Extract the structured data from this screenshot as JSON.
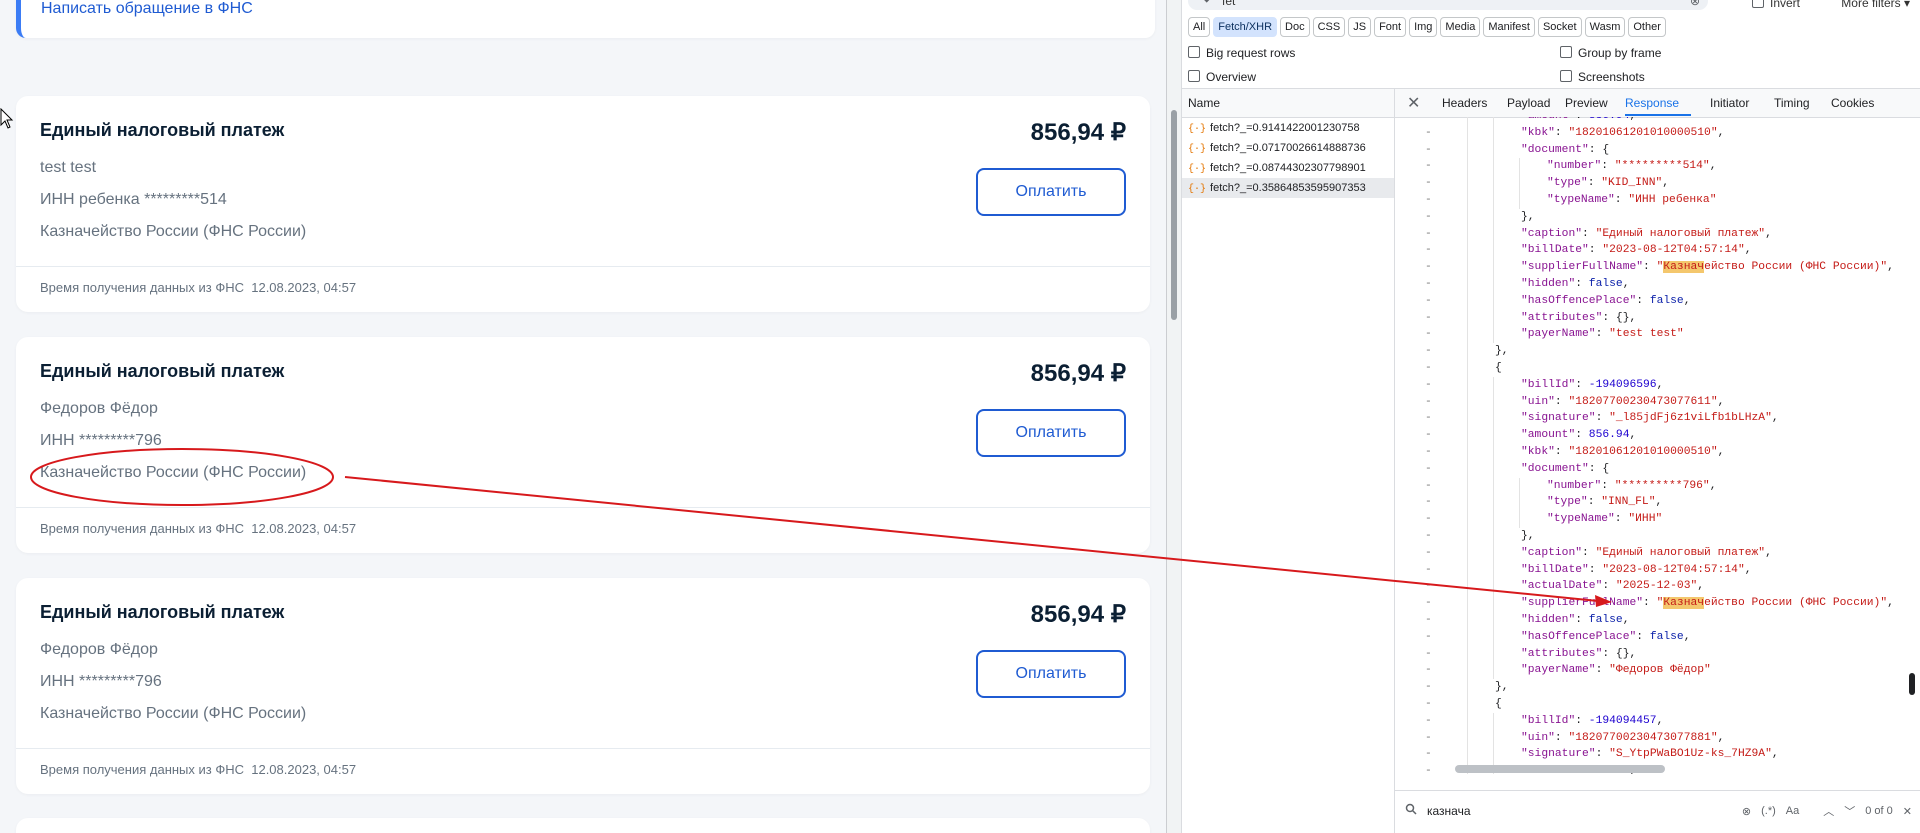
{
  "page": {
    "fns_link": "Написать обращение в ФНС",
    "bills": [
      {
        "title": "Единый налоговый платеж",
        "amount": "856,94 ₽",
        "payer": "test test",
        "inn": "ИНН ребенка *********514",
        "supplier": "Казначейство России (ФНС России)",
        "pay_label": "Оплатить",
        "footer": "Время получения данных из ФНС  12.08.2023, 04:57"
      },
      {
        "title": "Единый налоговый платеж",
        "amount": "856,94 ₽",
        "payer": "Федоров Фёдор",
        "inn": "ИНН *********796",
        "supplier": "Казначейство России (ФНС России)",
        "pay_label": "Оплатить",
        "footer": "Время получения данных из ФНС  12.08.2023, 04:57"
      },
      {
        "title": "Единый налоговый платеж",
        "amount": "856,94 ₽",
        "payer": "Федоров Фёдор",
        "inn": "ИНН *********796",
        "supplier": "Казначейство России (ФНС России)",
        "pay_label": "Оплатить",
        "footer": "Время получения данных из ФНС  12.08.2023, 04:57"
      }
    ]
  },
  "devtools": {
    "filter": {
      "value": "fet",
      "invert_label": "Invert",
      "more_filters_label": "More filters ▾"
    },
    "types": [
      "All",
      "Fetch/XHR",
      "Doc",
      "CSS",
      "JS",
      "Font",
      "Img",
      "Media",
      "Manifest",
      "Socket",
      "Wasm",
      "Other"
    ],
    "active_type": "Fetch/XHR",
    "options": {
      "big_rows": "Big request rows",
      "group_by_frame": "Group by frame",
      "overview": "Overview",
      "screenshots": "Screenshots"
    },
    "name_header": "Name",
    "requests": [
      "fetch?_=0.9141422001230758",
      "fetch?_=0.07170026614888736",
      "fetch?_=0.08744302307798901",
      "fetch?_=0.35864853595907353"
    ],
    "tabs": [
      "Headers",
      "Payload",
      "Preview",
      "Response",
      "Initiator",
      "Timing",
      "Cookies"
    ],
    "active_tab": "Response",
    "search": {
      "value": "казнача",
      "regex": "(.*)",
      "case": "Aa",
      "count": "0 of 0"
    }
  },
  "colors": {
    "accent": "#1f5bd2",
    "annotation": "#d7191c",
    "highlight": "#f4c76d"
  }
}
